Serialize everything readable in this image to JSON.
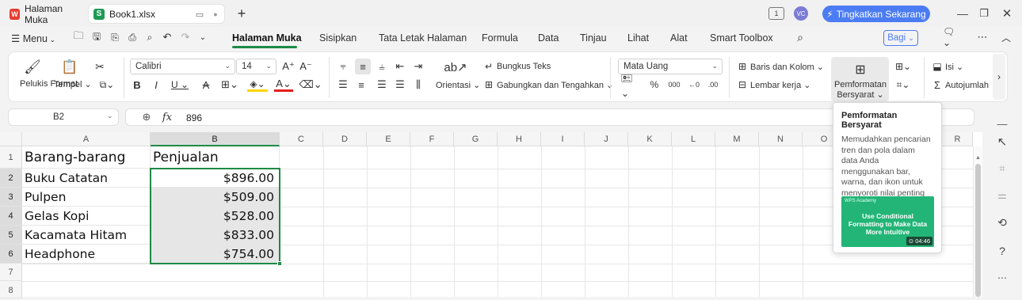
{
  "titlebar": {
    "tabs": [
      {
        "label": "Halaman Muka",
        "icon": "wps-logo-icon"
      },
      {
        "label": "Book1.xlsx",
        "icon": "spreadsheet-icon"
      }
    ],
    "user_initials": "VC",
    "upgrade_label": "Tingkatkan Sekarang",
    "accent": "#4b7cf3"
  },
  "menubar": {
    "menu_label": "Menu",
    "tabs": [
      "Halaman Muka",
      "Sisipkan",
      "Tata Letak Halaman",
      "Formula",
      "Data",
      "Tinjau",
      "Lihat",
      "Alat",
      "Smart Toolbox"
    ],
    "share_label": "Bagi"
  },
  "ribbon": {
    "format_painter": "Pelukis Format",
    "paste": "Tempel",
    "font_name": "Calibri",
    "font_size": "14",
    "orientation": "Orientasi",
    "wrap_text": "Bungkus Teks",
    "merge_center": "Gabungkan dan Tengahkan",
    "number_format": "Mata Uang",
    "rows_cols": "Baris dan Kolom",
    "worksheet": "Lembar kerja",
    "cond_format_line1": "Pemformatan",
    "cond_format_line2": "Bersyarat",
    "fill": "Isi",
    "autosum": "Autojumlah"
  },
  "formula_bar": {
    "name_box": "B2",
    "formula_value": "896"
  },
  "columns": [
    "A",
    "B",
    "C",
    "D",
    "E",
    "F",
    "G",
    "H",
    "I",
    "J",
    "K",
    "L",
    "M",
    "N",
    "O",
    "R"
  ],
  "rows": [
    "1",
    "2",
    "3",
    "4",
    "5",
    "6",
    "7",
    "8"
  ],
  "sheet": {
    "header_a": "Barang-barang",
    "header_b": "Penjualan",
    "items": [
      {
        "name": "Buku Catatan",
        "value": "$896.00"
      },
      {
        "name": "Pulpen",
        "value": "$509.00"
      },
      {
        "name": "Gelas Kopi",
        "value": "$528.00"
      },
      {
        "name": "Kacamata Hitam",
        "value": "$833.00"
      },
      {
        "name": "Headphone",
        "value": "$754.00"
      }
    ]
  },
  "tooltip": {
    "title": "Pemformatan Bersyarat",
    "body": "Memudahkan pencarian tren dan pola dalam data Anda menggunakan bar, warna, dan ikon untuk menyoroti nilai penting secara visual.",
    "video_brand": "WPS Academy",
    "video_title": "Use Conditional Formatting to Make Data More Intuitive",
    "video_duration": "04:46"
  }
}
